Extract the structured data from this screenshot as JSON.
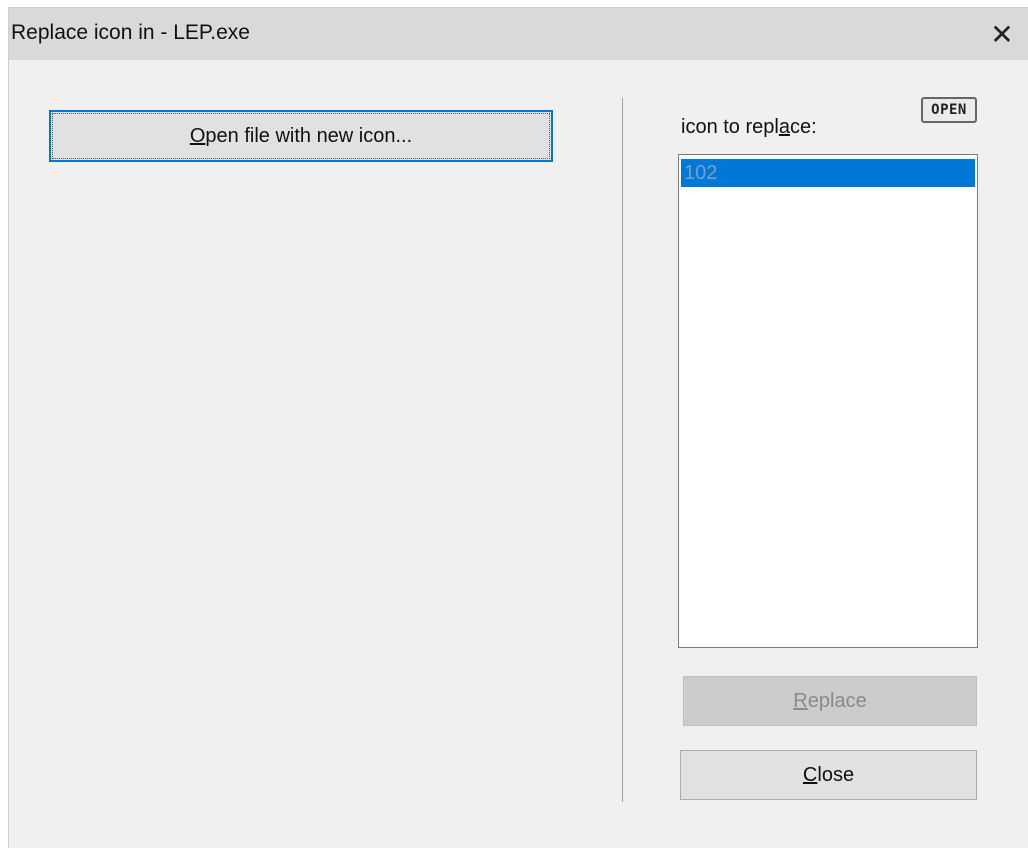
{
  "window": {
    "title": "Replace icon in - LEP.exe",
    "close_glyph": "✕"
  },
  "left_panel": {
    "open_button": {
      "mnemonic": "O",
      "rest": "pen file with new icon..."
    }
  },
  "right_panel": {
    "label": {
      "before": "icon to repl",
      "mnemonic": "a",
      "after": "ce:"
    },
    "open_badge": "OPEN",
    "icon_list": [
      {
        "label": "102",
        "selected": true
      }
    ],
    "replace_button": {
      "mnemonic": "R",
      "rest": "eplace",
      "enabled": false
    },
    "close_button": {
      "mnemonic": "C",
      "rest": "lose"
    }
  },
  "colors": {
    "accent": "#0078d7",
    "titlebar": "#d9d9d9",
    "window_bg": "#f0f0f0"
  }
}
